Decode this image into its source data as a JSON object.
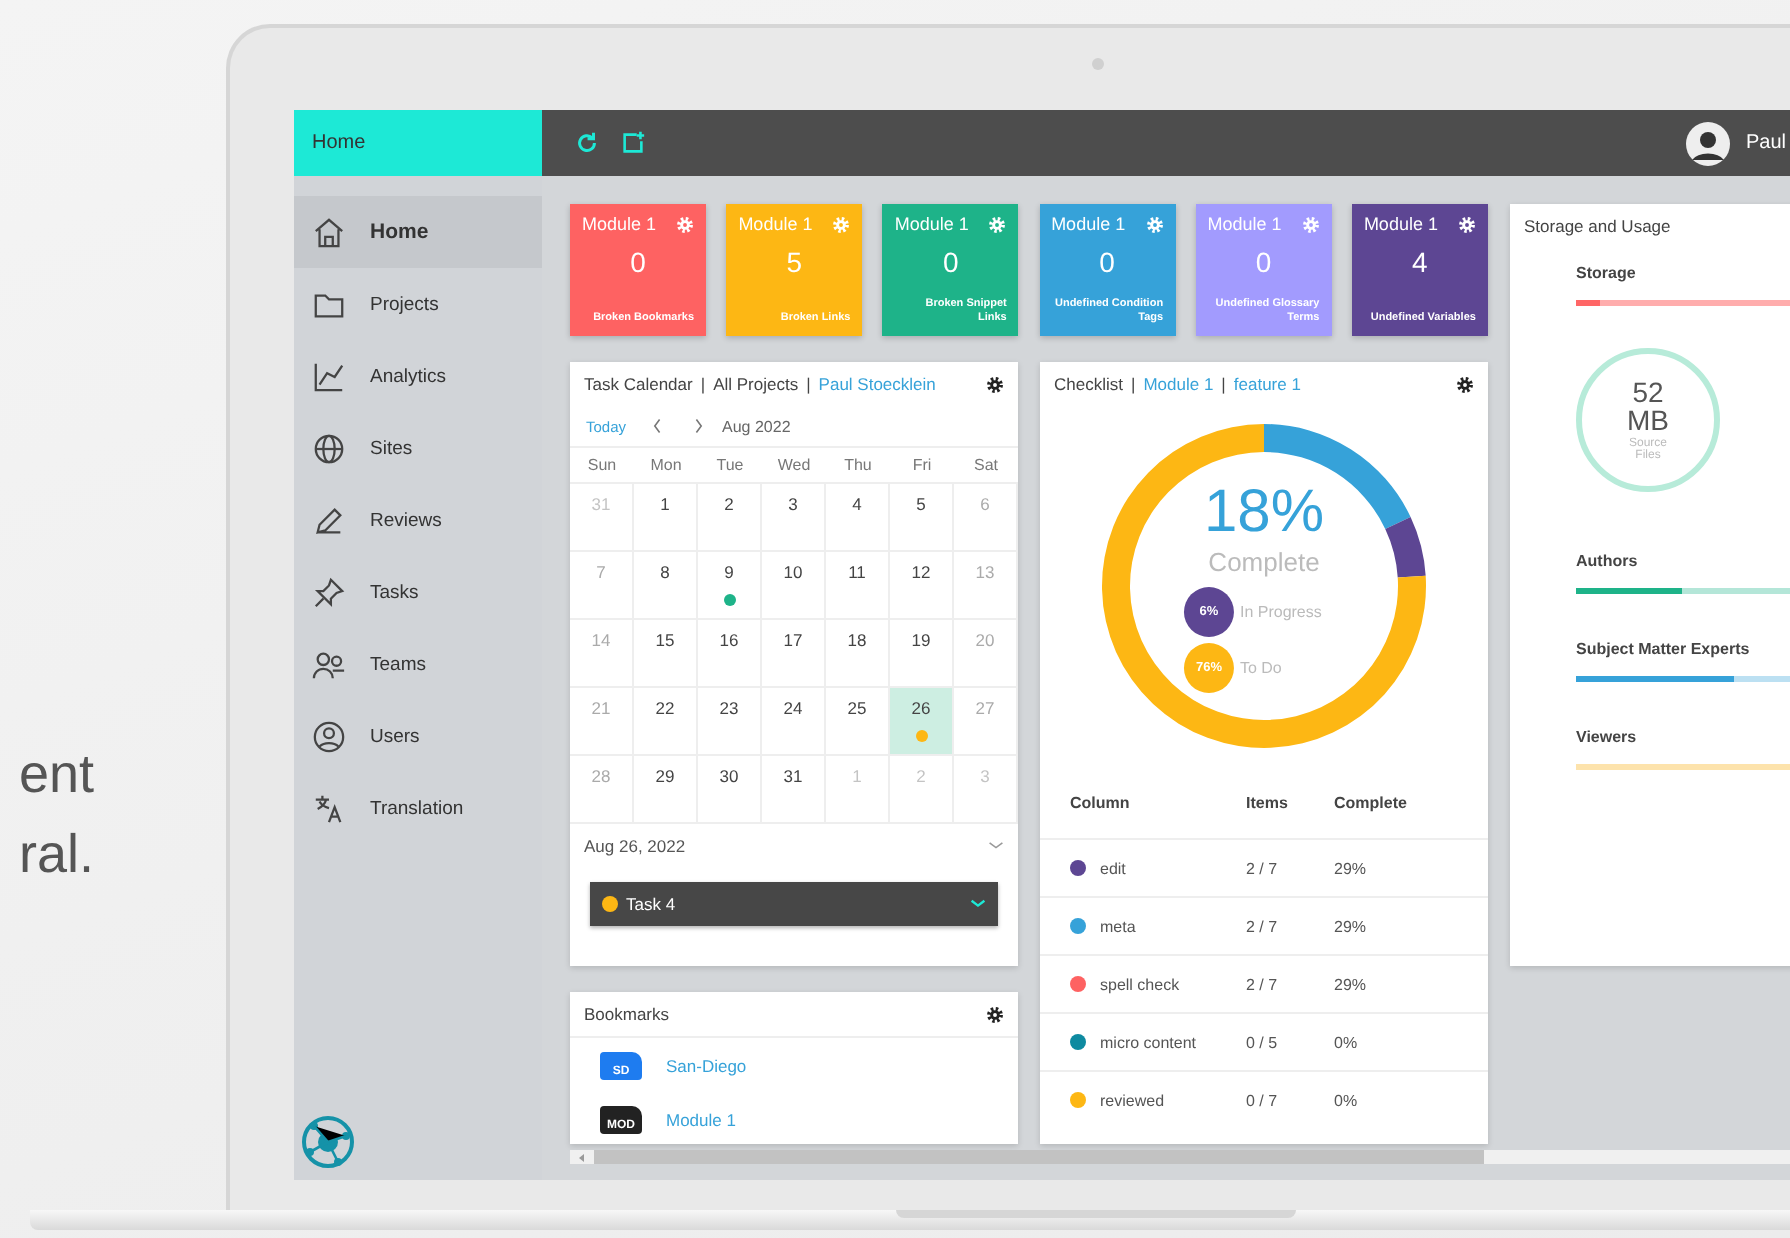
{
  "backdrop_text": [
    "ent",
    "ral."
  ],
  "topbar": {
    "title": "Home",
    "user": "Paul"
  },
  "sidebar": {
    "items": [
      {
        "label": "Home",
        "kind": "home",
        "selected": true
      },
      {
        "label": "Projects",
        "kind": "folder",
        "selected": false
      },
      {
        "label": "Analytics",
        "kind": "chart",
        "selected": false
      },
      {
        "label": "Sites",
        "kind": "globe",
        "selected": false
      },
      {
        "label": "Reviews",
        "kind": "pen",
        "selected": false
      },
      {
        "label": "Tasks",
        "kind": "pin",
        "selected": false
      },
      {
        "label": "Teams",
        "kind": "team",
        "selected": false
      },
      {
        "label": "Users",
        "kind": "user",
        "selected": false
      },
      {
        "label": "Translation",
        "kind": "translate",
        "selected": false
      }
    ]
  },
  "tiles": [
    {
      "title": "Module 1",
      "count": "0",
      "label": "Broken Bookmarks",
      "color": "#fe6262"
    },
    {
      "title": "Module 1",
      "count": "5",
      "label": "Broken Links",
      "color": "#fdb714"
    },
    {
      "title": "Module 1",
      "count": "0",
      "label": "Broken Snippet Links",
      "color": "#1eb389"
    },
    {
      "title": "Module 1",
      "count": "0",
      "label": "Undefined Condition Tags",
      "color": "#36a2d9"
    },
    {
      "title": "Module 1",
      "count": "0",
      "label": "Undefined Glossary Terms",
      "color": "#a29bfe"
    },
    {
      "title": "Module 1",
      "count": "4",
      "label": "Undefined Variables",
      "color": "#5d4693"
    }
  ],
  "calendar": {
    "separator": "|",
    "header": [
      {
        "text": "Task Calendar",
        "kind": "plain"
      },
      {
        "text": "All Projects",
        "kind": "plain"
      },
      {
        "text": "Paul Stoecklein",
        "kind": "link"
      }
    ],
    "today": "Today",
    "month": "Aug 2022",
    "weekdays": [
      "Sun",
      "Mon",
      "Tue",
      "Wed",
      "Thu",
      "Fri",
      "Sat"
    ],
    "weeks": [
      {
        "days": [
          {
            "n": "31",
            "kind": "outside",
            "selected": false
          },
          {
            "n": "1",
            "kind": "weekday",
            "selected": false
          },
          {
            "n": "2",
            "kind": "weekday",
            "selected": false
          },
          {
            "n": "3",
            "kind": "weekday",
            "selected": false
          },
          {
            "n": "4",
            "kind": "weekday",
            "selected": false
          },
          {
            "n": "5",
            "kind": "weekday",
            "selected": false
          },
          {
            "n": "6",
            "kind": "weekend",
            "selected": false
          }
        ]
      },
      {
        "days": [
          {
            "n": "7",
            "kind": "weekend",
            "selected": false
          },
          {
            "n": "8",
            "kind": "weekday",
            "selected": false
          },
          {
            "n": "9",
            "kind": "weekday",
            "selected": false,
            "color": "#1eb389"
          },
          {
            "n": "10",
            "kind": "weekday",
            "selected": false
          },
          {
            "n": "11",
            "kind": "weekday",
            "selected": false
          },
          {
            "n": "12",
            "kind": "weekday",
            "selected": false
          },
          {
            "n": "13",
            "kind": "weekend",
            "selected": false
          }
        ]
      },
      {
        "days": [
          {
            "n": "14",
            "kind": "weekend",
            "selected": false
          },
          {
            "n": "15",
            "kind": "weekday",
            "selected": false
          },
          {
            "n": "16",
            "kind": "weekday",
            "selected": false
          },
          {
            "n": "17",
            "kind": "weekday",
            "selected": false
          },
          {
            "n": "18",
            "kind": "weekday",
            "selected": false
          },
          {
            "n": "19",
            "kind": "weekday",
            "selected": false
          },
          {
            "n": "20",
            "kind": "weekend",
            "selected": false
          }
        ]
      },
      {
        "days": [
          {
            "n": "21",
            "kind": "weekend",
            "selected": false
          },
          {
            "n": "22",
            "kind": "weekday",
            "selected": false
          },
          {
            "n": "23",
            "kind": "weekday",
            "selected": false
          },
          {
            "n": "24",
            "kind": "weekday",
            "selected": false
          },
          {
            "n": "25",
            "kind": "weekday",
            "selected": false
          },
          {
            "n": "26",
            "kind": "weekday",
            "selected": true,
            "color": "#fdb714"
          },
          {
            "n": "27",
            "kind": "weekend",
            "selected": false
          }
        ]
      },
      {
        "days": [
          {
            "n": "28",
            "kind": "weekend",
            "selected": false
          },
          {
            "n": "29",
            "kind": "weekday",
            "selected": false
          },
          {
            "n": "30",
            "kind": "weekday",
            "selected": false
          },
          {
            "n": "31",
            "kind": "weekday",
            "selected": false
          },
          {
            "n": "1",
            "kind": "outside",
            "selected": false
          },
          {
            "n": "2",
            "kind": "outside",
            "selected": false
          },
          {
            "n": "3",
            "kind": "outside",
            "selected": false
          }
        ]
      }
    ],
    "selected_date": "Aug 26, 2022",
    "task": {
      "label": "Task 4",
      "color": "#fdb714"
    }
  },
  "bookmarks": {
    "title": "Bookmarks",
    "items": [
      {
        "badge": "SD",
        "label": "San-Diego",
        "color": "#1e7cf0"
      },
      {
        "badge": "MOD",
        "label": "Module 1",
        "color": "#222222"
      }
    ]
  },
  "checklist": {
    "separator": "|",
    "header": [
      {
        "text": "Checklist",
        "kind": "plain"
      },
      {
        "text": "Module 1",
        "kind": "link"
      },
      {
        "text": "feature 1",
        "kind": "link"
      }
    ],
    "summary": {
      "value": "18%",
      "color": "#36a2d9"
    },
    "legend": [
      {
        "value": "6%",
        "color": "#5d4693"
      },
      {
        "value": "76%",
        "color": "#fdb714"
      }
    ],
    "chart_data": {
      "type": "donut",
      "categories": [
        "Complete",
        "In Progress",
        "To Do"
      ],
      "values": [
        18,
        6,
        76
      ]
    },
    "columns": [
      "Column",
      "Items",
      "Complete"
    ],
    "rows": [
      {
        "name": "edit",
        "items": "2 / 7",
        "complete": "29%",
        "color": "#5d4693"
      },
      {
        "name": "meta",
        "items": "2 / 7",
        "complete": "29%",
        "color": "#36a2d9"
      },
      {
        "name": "spell check",
        "items": "2 / 7",
        "complete": "29%",
        "color": "#fe6262"
      },
      {
        "name": "micro content",
        "items": "0 / 5",
        "complete": "0%",
        "color": "#0e8aa0"
      },
      {
        "name": "reviewed",
        "items": "0 / 7",
        "complete": "0%",
        "color": "#fdb714"
      }
    ]
  },
  "storage": {
    "title": "Storage and Usage",
    "heading": "Storage",
    "level": 0.05,
    "color": "#f66",
    "ring": {
      "value": "52",
      "unit": "MB",
      "label": "Source Files"
    },
    "groups": [
      {
        "label": "Authors",
        "level": 0.22,
        "color": "#1eb389"
      },
      {
        "label": "Subject Matter Experts",
        "level": 0.33,
        "color": "#36a2d9"
      },
      {
        "label": "Viewers",
        "level": 0,
        "color": "#fde3ac"
      }
    ]
  }
}
